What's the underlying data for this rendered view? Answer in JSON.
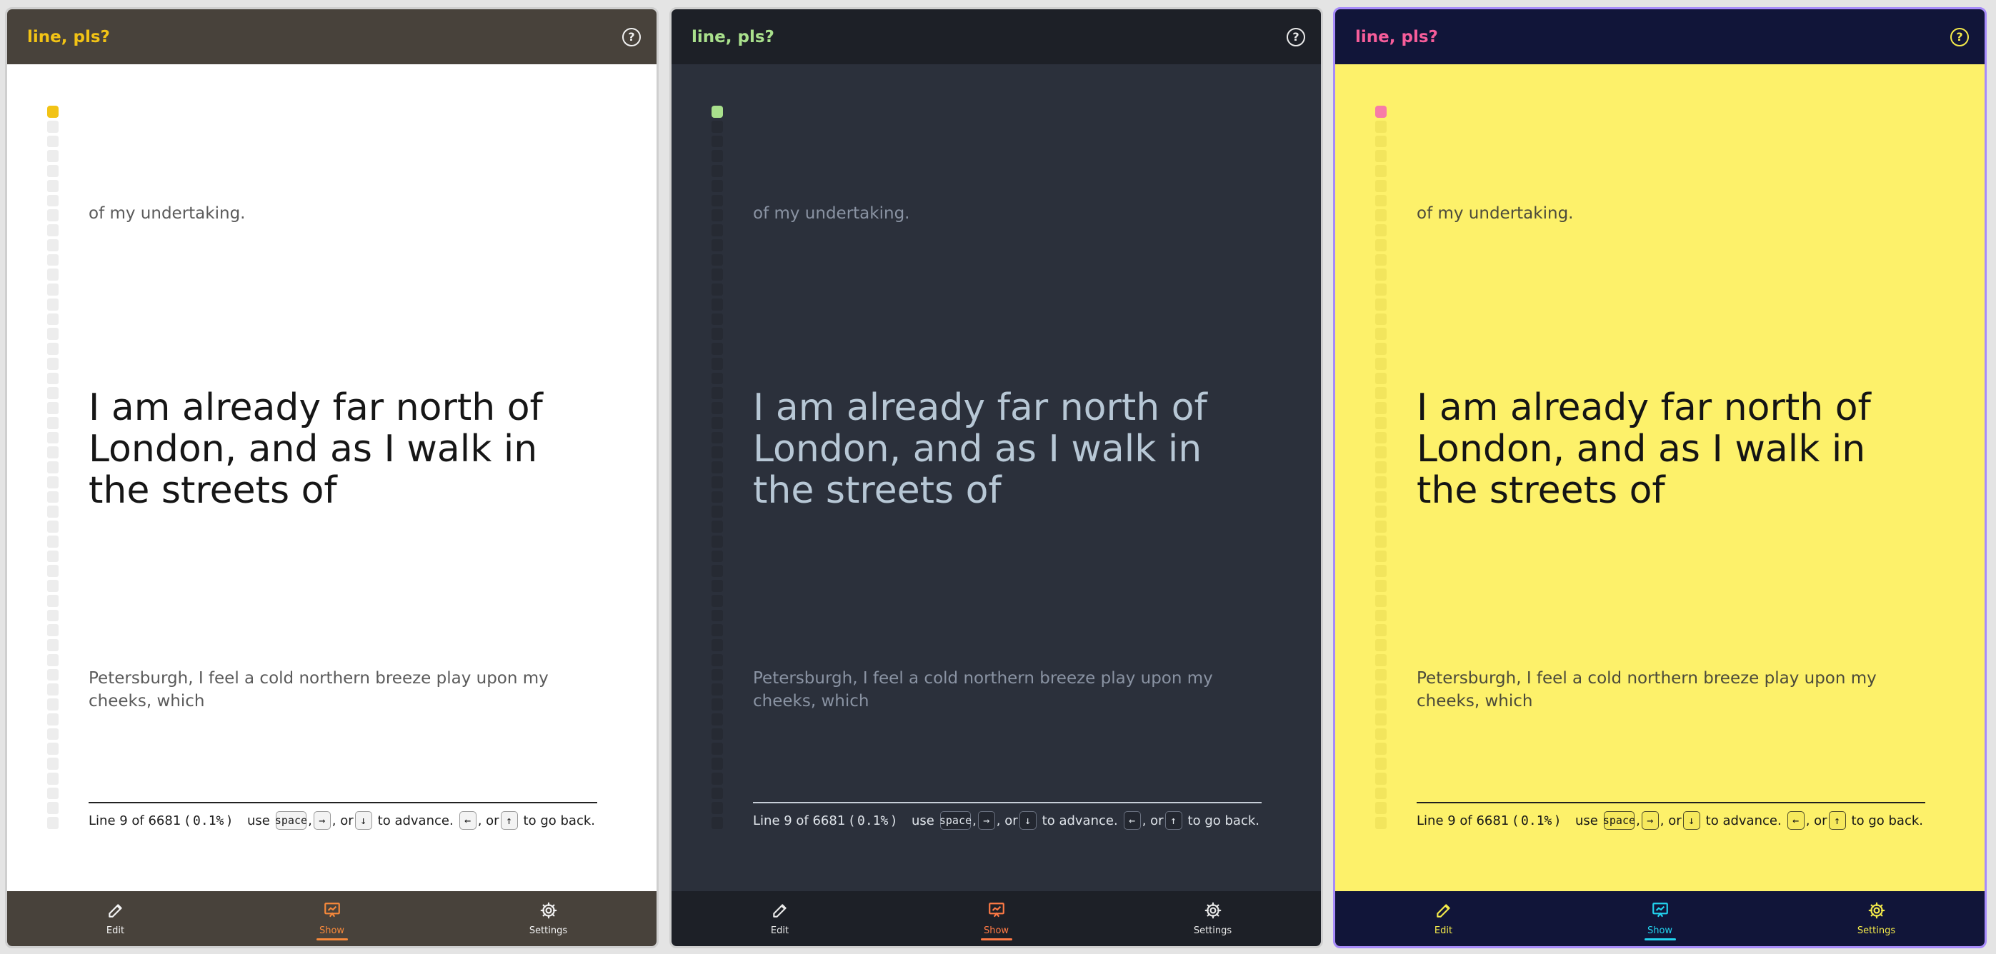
{
  "app_title": "line, pls?",
  "help_glyph": "?",
  "reading": {
    "previous_line": "of my undertaking.",
    "current_line": "I am already far north of London, and as I walk in the streets of",
    "next_line": "Petersburgh, I feel a cold northern breeze play upon my cheeks, which"
  },
  "status": {
    "line_label": "Line 9 of 6681 (",
    "percent": "0.1%",
    "close_paren": ")",
    "use": "use",
    "key_space": "space",
    "comma1": ",",
    "key_right": "→",
    "or1": ", or",
    "key_down": "↓",
    "advance": "to advance.",
    "key_left": "←",
    "or2": ", or",
    "key_up": "↑",
    "back": "to go back."
  },
  "nav": {
    "edit": "Edit",
    "show": "Show",
    "settings": "Settings"
  },
  "themes": [
    {
      "name": "light",
      "header_bg": "#48423b",
      "title": "#f2c315",
      "body_bg": "#ffffff",
      "rail": "#ededed",
      "rail_current": "#f2c315",
      "faint_text": "#5a5a5a",
      "main_text": "#161616",
      "divider": "#222222",
      "status_text": "#1c1c1c",
      "kbd_bg": "#f3f3f3",
      "kbd_border": "#9a9a9a",
      "nav_bg": "#48423b",
      "nav_text": "#f4f4f4",
      "nav_active": "#f7893b",
      "help": "#f1f1f1"
    },
    {
      "name": "dark",
      "header_bg": "#1d2027",
      "title": "#a9e08c",
      "body_bg": "#2b303b",
      "rail": "#262a33",
      "rail_current": "#a9e08c",
      "faint_text": "#8a93a3",
      "main_text": "#b7c7d5",
      "divider": "#c7ced8",
      "status_text": "#dfe4ea",
      "kbd_bg": "#232730",
      "kbd_border": "#6a7180",
      "nav_bg": "#1d2027",
      "nav_text": "#e8e8e8",
      "nav_active": "#ff7a45",
      "help": "#e9e9e9"
    },
    {
      "name": "yellow",
      "header_bg": "#111539",
      "title": "#f75d9a",
      "body_bg": "#fdf16a",
      "rail": "#f2e55d",
      "rail_current": "#f77ca7",
      "faint_text": "#4b4a3a",
      "main_text": "#141414",
      "divider": "#1f1f1f",
      "status_text": "#161616",
      "kbd_bg": "#f6e95d",
      "kbd_border": "#4d4a28",
      "nav_bg": "#111539",
      "nav_text": "#f4ea4a",
      "nav_active": "#22d3ee",
      "help": "#f4ea4a"
    }
  ]
}
